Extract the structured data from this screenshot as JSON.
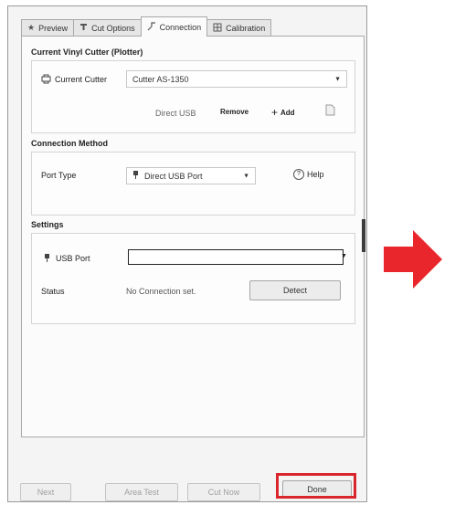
{
  "tabs": [
    {
      "label": "Preview",
      "icon": "star-icon"
    },
    {
      "label": "Cut Options",
      "icon": "cutter-icon"
    },
    {
      "label": "Connection",
      "icon": "connection-icon"
    },
    {
      "label": "Calibration",
      "icon": "calibration-icon"
    }
  ],
  "current_cutter": {
    "title": "Current Vinyl Cutter (Plotter)",
    "label": "Current Cutter",
    "value": "Cutter AS-1350",
    "connection_text": "Direct USB",
    "remove_label": "Remove",
    "add_label": "Add"
  },
  "connection_method": {
    "title": "Connection Method",
    "port_type_label": "Port Type",
    "port_type_value": "Direct USB Port",
    "help_label": "Help"
  },
  "settings": {
    "title": "Settings",
    "usb_port_label": "USB Port",
    "usb_port_value": "",
    "status_label": "Status",
    "status_value": "No Connection set.",
    "detect_label": "Detect"
  },
  "footer": {
    "next_label": "Next",
    "area_test_label": "Area Test",
    "cut_now_label": "Cut Now",
    "done_label": "Done"
  },
  "colors": {
    "highlight": "#d9262c",
    "arrow": "#e8262c"
  }
}
